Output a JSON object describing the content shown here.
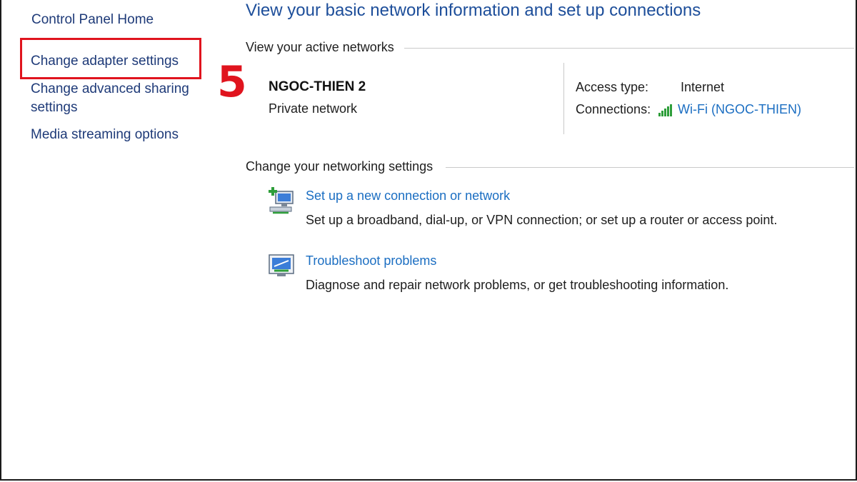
{
  "sidebar": {
    "home": "Control Panel Home",
    "adapter": "Change adapter settings",
    "advanced_sharing": "Change advanced sharing settings",
    "media_streaming": "Media streaming options"
  },
  "annotation": {
    "step": "5",
    "color": "#e0141e"
  },
  "main": {
    "title": "View your basic network information and set up connections",
    "active_heading": "View your active networks",
    "network": {
      "name": "NGOC-THIEN 2",
      "type": "Private network",
      "access_label": "Access type:",
      "access_value": "Internet",
      "connections_label": "Connections:",
      "connections_value": "Wi-Fi (NGOC-THIEN)",
      "connections_icon": "wifi-signal-icon"
    },
    "change_heading": "Change your networking settings",
    "tasks": [
      {
        "icon": "new-connection-icon",
        "link": "Set up a new connection or network",
        "description": "Set up a broadband, dial-up, or VPN connection; or set up a router or access point."
      },
      {
        "icon": "troubleshoot-icon",
        "link": "Troubleshoot problems",
        "description": "Diagnose and repair network problems, or get troubleshooting information."
      }
    ]
  },
  "colors": {
    "title": "#1d4e9a",
    "link": "#1b6ec2",
    "sidebar_link": "#1e3a78",
    "signal": "#2e9e3a"
  }
}
